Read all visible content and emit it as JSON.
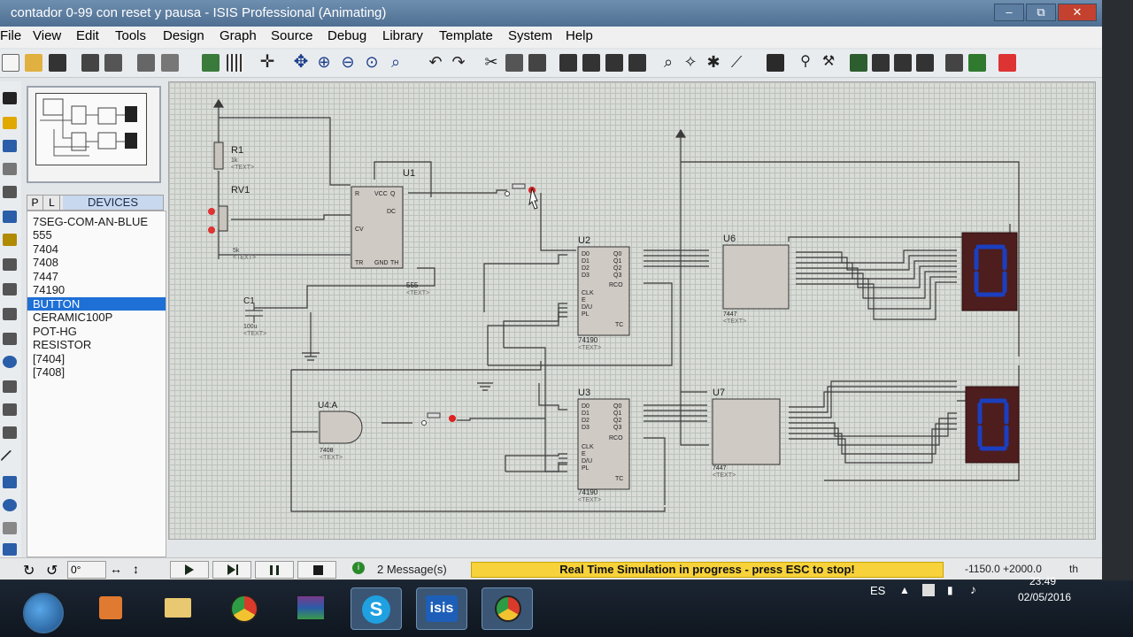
{
  "window": {
    "title": "contador 0-99 con reset y pausa - ISIS Professional (Animating)",
    "minimize": "–",
    "restore": "⧉",
    "close": "✕"
  },
  "menu": [
    "File",
    "View",
    "Edit",
    "Tools",
    "Design",
    "Graph",
    "Source",
    "Debug",
    "Library",
    "Template",
    "System",
    "Help"
  ],
  "devices": {
    "tab_p": "P",
    "tab_l": "L",
    "header": "DEVICES",
    "items": [
      "7SEG-COM-AN-BLUE",
      "555",
      "7404",
      "7408",
      "7447",
      "74190",
      "BUTTON",
      "CERAMIC100P",
      "POT-HG",
      "RESISTOR",
      "[7404]",
      "[7408]"
    ],
    "selected": "BUTTON"
  },
  "schematic": {
    "labels": {
      "r1": "R1",
      "r1_val": "1k",
      "rv1": "RV1",
      "rv1_val": "5k",
      "c1": "C1",
      "c1_val": "100u",
      "u1": "U1",
      "u1_part": "555",
      "u2": "U2",
      "u2_part": "74190",
      "u3": "U3",
      "u3_part": "74190",
      "u4": "U4:A",
      "u4_part": "7408",
      "u6": "U6",
      "u6_part": "7447",
      "u7": "U7",
      "u7_part": "7447",
      "text": "<TEXT>",
      "digit1": "0",
      "digit2": "0"
    }
  },
  "status": {
    "rotation": "0°",
    "messages": "2 Message(s)",
    "simulation": "Real Time Simulation in progress - press ESC to stop!",
    "coord_x": "-1150.0",
    "coord_y": "+2000.0",
    "unit": "th"
  },
  "taskbar": {
    "lang": "ES",
    "time": "23:49",
    "date": "02/05/2016",
    "isis_label": "isis"
  },
  "colors": {
    "selection": "#1e6fd6",
    "segment": "#1b3fbf",
    "sim_banner": "#f7d23a",
    "wire": "#3a3a3a",
    "chip_fill": "#cfcac4"
  }
}
